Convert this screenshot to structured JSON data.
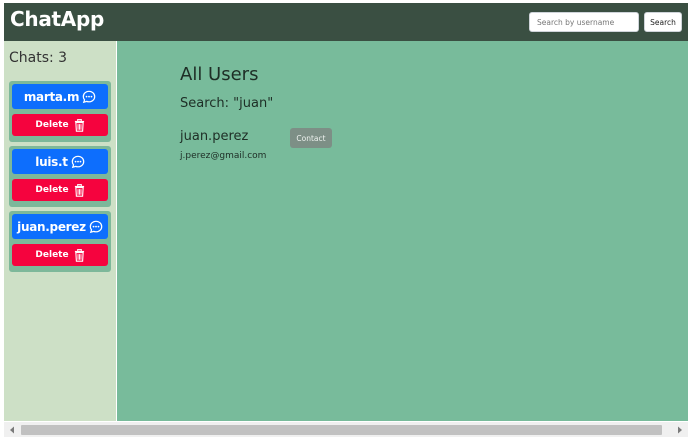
{
  "app": {
    "brand": "ChatApp"
  },
  "navbar": {
    "search_placeholder": "Search by username",
    "search_value": "",
    "search_button": "Search"
  },
  "sidebar": {
    "title": "Chats: 3",
    "chats": [
      {
        "username": "marta.m",
        "delete_label": "Delete",
        "icon": "chat-dots-icon",
        "delete_icon": "trash-icon"
      },
      {
        "username": "luis.t",
        "delete_label": "Delete",
        "icon": "chat-dots-icon",
        "delete_icon": "trash-icon"
      },
      {
        "username": "juan.perez",
        "delete_label": "Delete",
        "icon": "chat-dots-icon",
        "delete_icon": "trash-icon"
      }
    ]
  },
  "main": {
    "title": "All Users",
    "search_label": "Search: \"juan\"",
    "results": [
      {
        "username": "juan.perez",
        "email": "j.perez@gmail.com",
        "action_label": "Contact"
      }
    ]
  },
  "colors": {
    "navbar": "#3a4f42",
    "sidebar": "#cde0c6",
    "main": "#78bb9b",
    "primary": "#0d6efd",
    "danger": "#f5033e",
    "contact": "#7d8f86"
  }
}
